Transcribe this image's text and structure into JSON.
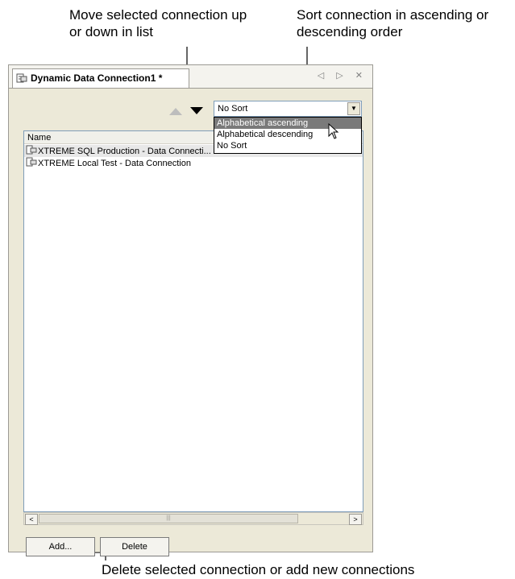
{
  "callouts": {
    "move": "Move selected connection up or down in list",
    "sort": "Sort connection in ascending or descending order",
    "bottom": "Delete selected connection or add new connections"
  },
  "tab": {
    "title": "Dynamic Data Connection1 *",
    "nav": "◁ ▷ ✕"
  },
  "toolbar": {
    "move_up_icon": "triangle-up",
    "move_down_icon": "triangle-down"
  },
  "sort": {
    "selected": "No Sort",
    "options": [
      "Alphabetical ascending",
      "Alphabetical descending",
      "No Sort"
    ],
    "highlighted_option": "Alphabetical ascending"
  },
  "list": {
    "column_header": "Name",
    "rows": [
      "XTREME SQL Production - Data Connecti...",
      "XTREME Local Test - Data Connection"
    ]
  },
  "scrollbar": {
    "left": "<",
    "right": ">",
    "grip": "|||"
  },
  "buttons": {
    "add": "Add...",
    "delete": "Delete"
  }
}
